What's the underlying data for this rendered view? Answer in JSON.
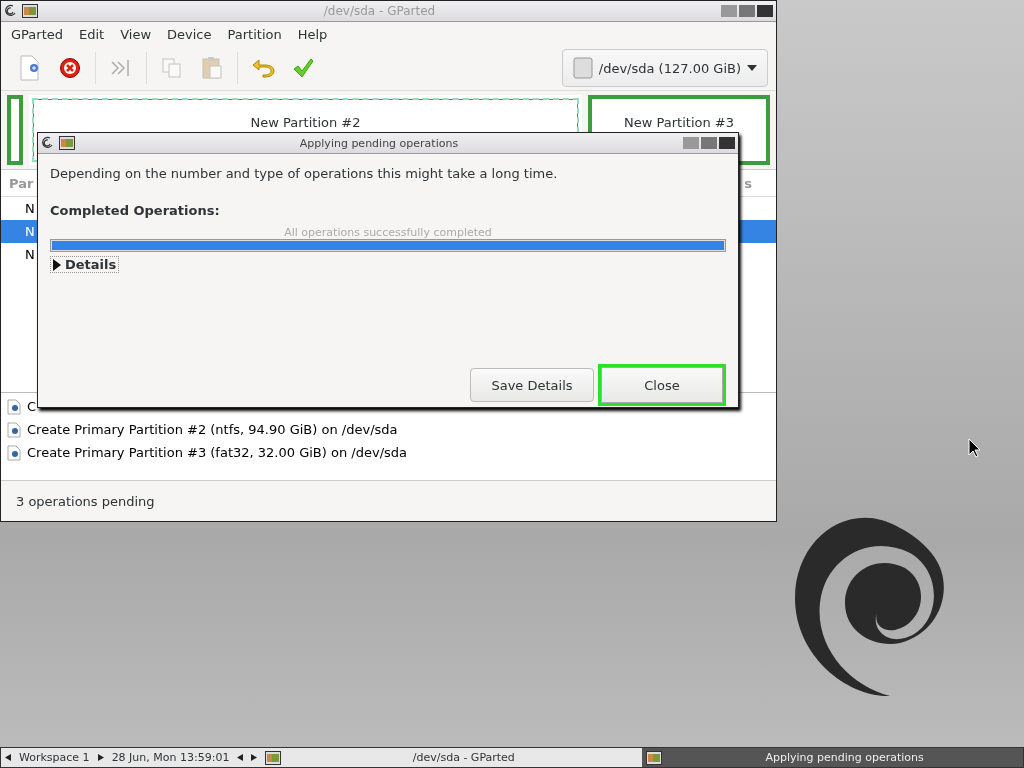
{
  "main_window": {
    "title": "/dev/sda - GParted",
    "menu": [
      "GParted",
      "Edit",
      "View",
      "Device",
      "Partition",
      "Help"
    ],
    "toolbar": [
      {
        "kind": "new",
        "disabled": false
      },
      {
        "kind": "delete",
        "disabled": false
      },
      {
        "kind": "resize",
        "disabled": true
      },
      {
        "kind": "copy",
        "disabled": true
      },
      {
        "kind": "paste",
        "disabled": true
      },
      {
        "kind": "undo",
        "disabled": false
      },
      {
        "kind": "apply",
        "disabled": false
      }
    ],
    "device": "/dev/sda (127.00 GiB)",
    "partitions": [
      {
        "selected": false
      },
      {
        "name": "New Partition #2",
        "selected": true
      },
      {
        "name": "New Partition #3",
        "selected": false
      }
    ],
    "list_header": {
      "column_1": "Par",
      "column_2": "s"
    },
    "list_rows": [
      {
        "label": "N",
        "selected": false
      },
      {
        "label": "N",
        "selected": true
      },
      {
        "label": "N",
        "selected": false
      }
    ],
    "operations": [
      "C",
      "Create Primary Partition #2 (ntfs, 94.90 GiB) on /dev/sda",
      "Create Primary Partition #3 (fat32, 32.00 GiB) on /dev/sda"
    ],
    "status_bar": "3 operations pending"
  },
  "dialog": {
    "title": "Applying pending operations",
    "message": "Depending on the number and type of operations this might take a long time.",
    "completed_label": "Completed Operations:",
    "progress": {
      "text": "All operations successfully completed",
      "level": 1
    },
    "details": {
      "label": "Details",
      "expanded": false
    },
    "buttons": [
      {
        "label": "Save Details",
        "focused": false
      },
      {
        "label": "Close",
        "focused": true
      }
    ]
  },
  "taskbar": {
    "workspace": "Workspace 1",
    "clock": "28 Jun, Mon 13:59:01",
    "windows": [
      {
        "title": "/dev/sda - GParted",
        "active": false
      },
      {
        "title": "Applying pending operations",
        "active": true
      }
    ]
  }
}
